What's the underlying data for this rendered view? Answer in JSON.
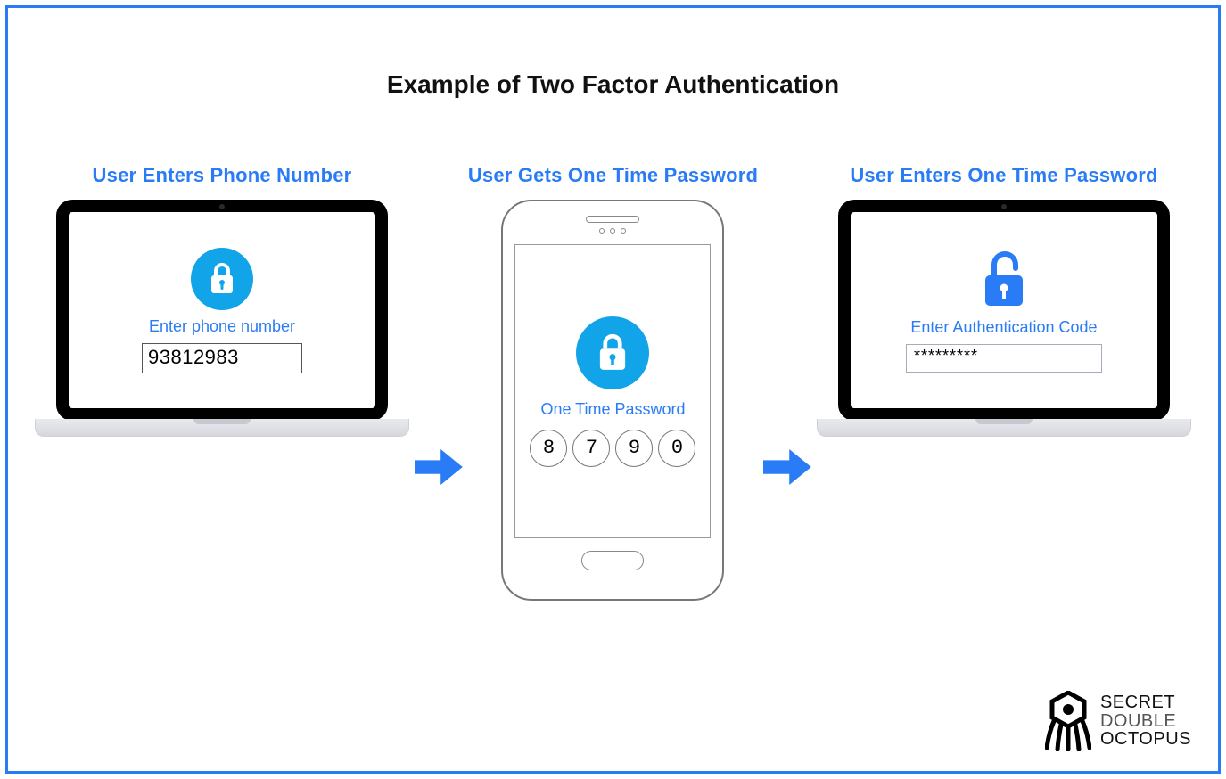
{
  "title": "Example of Two Factor Authentication",
  "colors": {
    "accent": "#2a7cf6",
    "lock_circle": "#12a4e8"
  },
  "steps": {
    "one": {
      "title": "User Enters  Phone Number",
      "field_label": "Enter phone number",
      "value": "93812983"
    },
    "two": {
      "title": "User Gets One Time Password",
      "field_label": "One Time Password",
      "otp": [
        "8",
        "7",
        "9",
        "0"
      ]
    },
    "three": {
      "title": "User Enters One Time Password",
      "field_label": "Enter Authentication Code",
      "value": "*********"
    }
  },
  "brand": {
    "line1": "SECRET",
    "line2": "DOUBLE",
    "line3": "OCTOPUS"
  }
}
